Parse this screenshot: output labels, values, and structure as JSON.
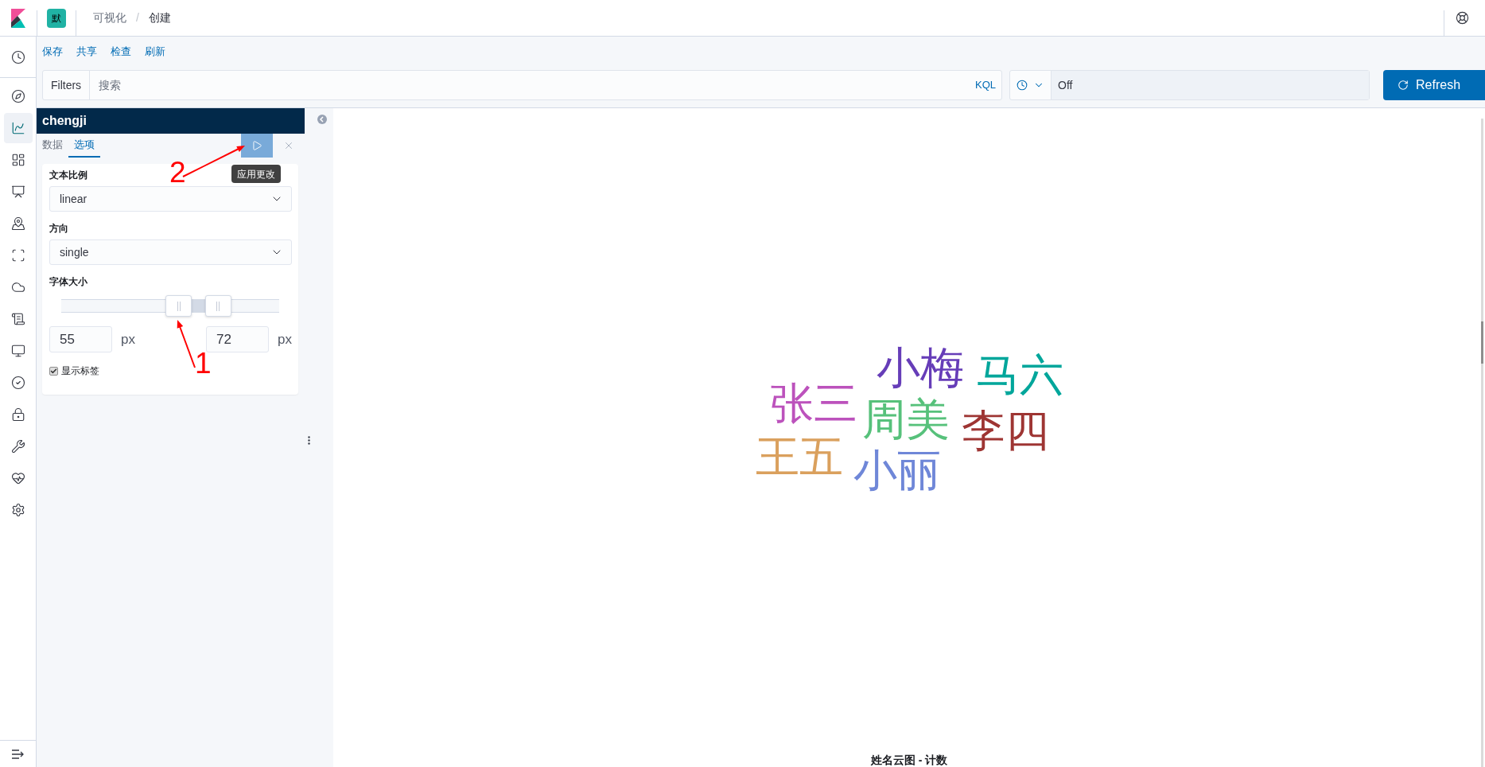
{
  "header": {
    "space_badge": "默",
    "breadcrumbs": [
      {
        "label": "可视化",
        "current": false
      },
      {
        "label": "创建",
        "current": true
      }
    ],
    "breadcrumb_separator": "/"
  },
  "side_nav": {
    "items": [
      {
        "selected": false
      },
      {
        "selected": false
      },
      {
        "selected": true
      },
      {
        "selected": false
      },
      {
        "selected": false
      },
      {
        "selected": false
      },
      {
        "selected": false
      },
      {
        "selected": false
      },
      {
        "selected": false
      },
      {
        "selected": false
      },
      {
        "selected": false
      },
      {
        "selected": false
      },
      {
        "selected": false
      },
      {
        "selected": false
      },
      {
        "selected": false
      }
    ]
  },
  "top_menu": [
    {
      "label": "保存"
    },
    {
      "label": "共享"
    },
    {
      "label": "检查"
    },
    {
      "label": "刷新"
    }
  ],
  "query_bar": {
    "filters_label": "Filters",
    "placeholder": "搜索",
    "language": "KQL",
    "refresh_interval": "Off",
    "refresh_button": "Refresh"
  },
  "editor": {
    "title": "chengji",
    "tabs": [
      {
        "label": "数据",
        "selected": false
      },
      {
        "label": "选项",
        "selected": true
      }
    ],
    "apply_tooltip": "应用更改",
    "options": {
      "text_scale": {
        "label": "文本比例",
        "value": "linear"
      },
      "orientation": {
        "label": "方向",
        "value": "single"
      },
      "font_size": {
        "label": "字体大小",
        "thumbs": [
          {
            "level": 0.54,
            "value": "55",
            "unit": "px"
          },
          {
            "level": 0.72,
            "value": "72",
            "unit": "px"
          }
        ]
      },
      "show_labels": {
        "label": "显示标签",
        "checked": true
      }
    }
  },
  "annotations": [
    {
      "label": "2"
    },
    {
      "label": "1"
    }
  ],
  "visualization": {
    "words": [
      {
        "text": "小梅",
        "color": "#663db8"
      },
      {
        "text": "马六",
        "color": "#00a69b"
      },
      {
        "text": "张三",
        "color": "#bc52bc"
      },
      {
        "text": "周美",
        "color": "#57c17b"
      },
      {
        "text": "李四",
        "color": "#9e3533"
      },
      {
        "text": "王五",
        "color": "#daa05d"
      },
      {
        "text": "小丽",
        "color": "#6f87d8"
      }
    ],
    "caption": "姓名云图 - 计数"
  }
}
